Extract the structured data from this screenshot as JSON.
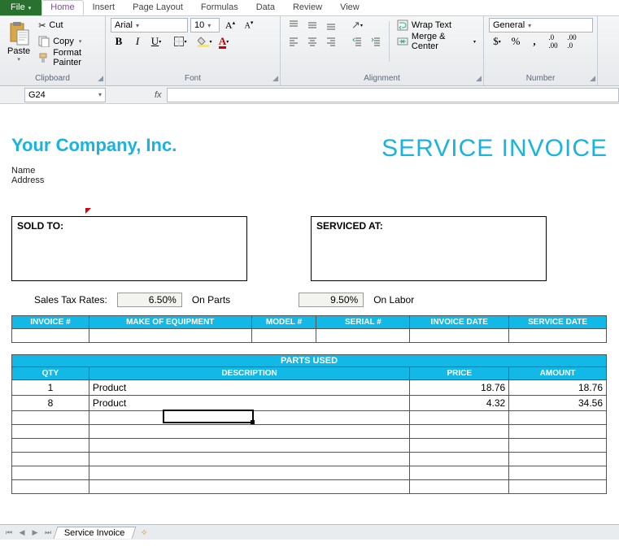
{
  "ribbon": {
    "tabs": {
      "file": "File",
      "home": "Home",
      "insert": "Insert",
      "page_layout": "Page Layout",
      "formulas": "Formulas",
      "data": "Data",
      "review": "Review",
      "view": "View"
    },
    "clipboard": {
      "paste": "Paste",
      "cut": "Cut",
      "copy": "Copy",
      "format_painter": "Format Painter",
      "label": "Clipboard"
    },
    "font": {
      "name": "Arial",
      "size": "10",
      "label": "Font"
    },
    "alignment": {
      "wrap": "Wrap Text",
      "merge": "Merge & Center",
      "label": "Alignment"
    },
    "number": {
      "format": "General",
      "label": "Number",
      "currency": "$",
      "percent": "%",
      "comma": ","
    }
  },
  "formula_bar": {
    "cell_ref": "G24",
    "fx": "fx",
    "value": ""
  },
  "doc": {
    "company": "Your Company, Inc.",
    "title": "SERVICE INVOICE",
    "name_label": "Name",
    "addr_label": "Address",
    "sold_to": "SOLD TO:",
    "serviced_at": "SERVICED AT:",
    "tax_label": "Sales Tax Rates:",
    "tax_parts": "6.50%",
    "on_parts": "On Parts",
    "tax_labor": "9.50%",
    "on_labor": "On Labor",
    "cols": {
      "inv": "INVOICE #",
      "make": "MAKE OF EQUIPMENT",
      "model": "MODEL #",
      "serial": "SERIAL #",
      "idate": "INVOICE DATE",
      "sdate": "SERVICE DATE"
    },
    "parts_band": "PARTS USED",
    "pcols": {
      "qty": "QTY",
      "desc": "DESCRIPTION",
      "price": "PRICE",
      "amount": "AMOUNT"
    },
    "rows": [
      {
        "qty": "1",
        "desc": "Product",
        "price": "18.76",
        "amount": "18.76"
      },
      {
        "qty": "8",
        "desc": "Product",
        "price": "4.32",
        "amount": "34.56"
      }
    ]
  },
  "sheet_tab": "Service Invoice",
  "chart_data": {
    "type": "table",
    "title": "PARTS USED",
    "columns": [
      "QTY",
      "DESCRIPTION",
      "PRICE",
      "AMOUNT"
    ],
    "rows": [
      [
        1,
        "Product",
        18.76,
        18.76
      ],
      [
        8,
        "Product",
        4.32,
        34.56
      ]
    ]
  }
}
